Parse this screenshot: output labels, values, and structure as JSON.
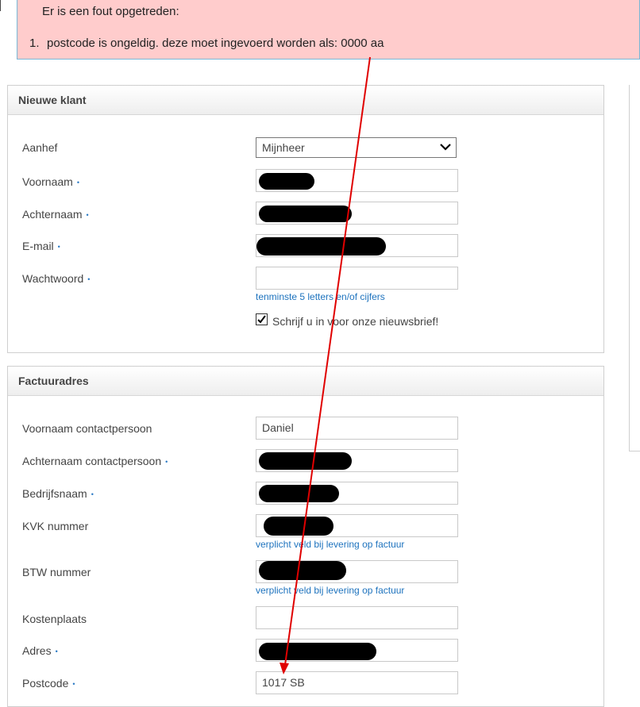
{
  "error": {
    "heading": "Er is een fout opgetreden:",
    "items": [
      {
        "number": "1.",
        "text": "postcode is ongeldig. deze moet ingevoerd worden als: 0000 aa"
      }
    ]
  },
  "customer_panel": {
    "title": "Nieuwe klant",
    "salutation": {
      "label": "Aanhef",
      "value": "Mijnheer"
    },
    "first_name": {
      "label": "Voornaam"
    },
    "last_name": {
      "label": "Achternaam"
    },
    "email": {
      "label": "E-mail"
    },
    "password": {
      "label": "Wachtwoord",
      "hint": "tenminste 5 letters en/of cijfers"
    },
    "newsletter": {
      "label": "Schrijf u in voor onze nieuwsbrief!",
      "checked": true
    }
  },
  "billing_panel": {
    "title": "Factuuradres",
    "contact_first_name": {
      "label": "Voornaam contactpersoon",
      "value": "Daniel"
    },
    "contact_last_name": {
      "label": "Achternaam contactpersoon"
    },
    "company": {
      "label": "Bedrijfsnaam"
    },
    "kvk": {
      "label": "KVK nummer",
      "hint": "verplicht veld bij levering op factuur"
    },
    "btw": {
      "label": "BTW nummer",
      "hint": "verplicht veld bij levering op factuur"
    },
    "cost_center": {
      "label": "Kostenplaats"
    },
    "address": {
      "label": "Adres"
    },
    "postcode": {
      "label": "Postcode",
      "value": "1017 SB"
    }
  },
  "colors": {
    "error_bg": "#ffcccc",
    "link": "#1e73be",
    "annotation_arrow": "#e00000"
  }
}
